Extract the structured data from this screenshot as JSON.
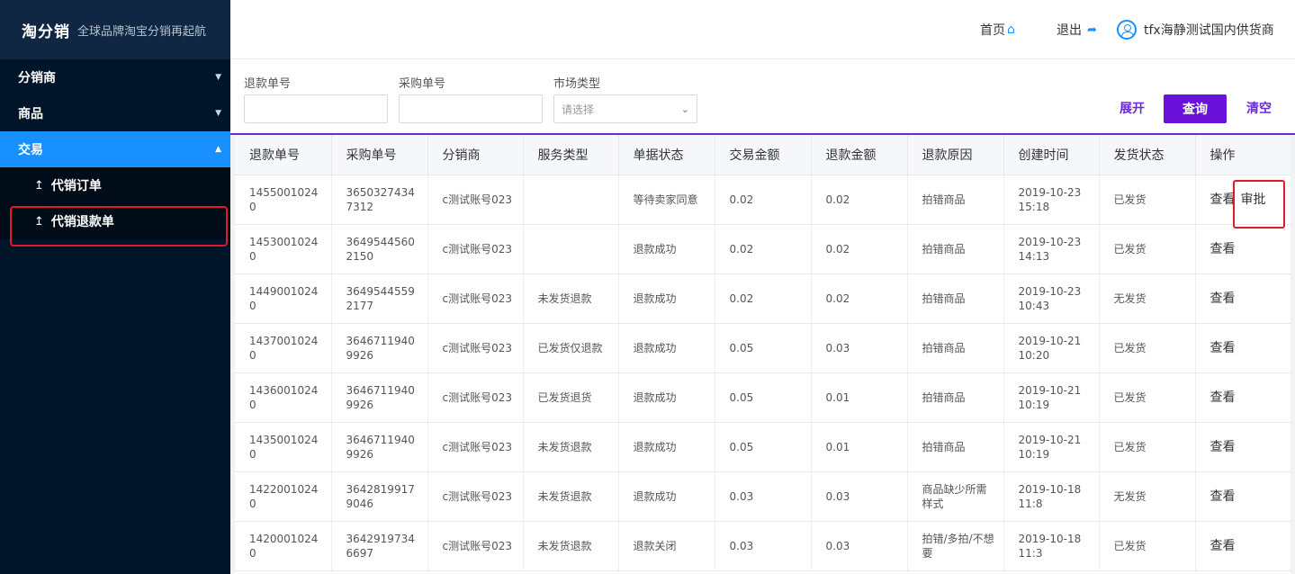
{
  "sidebar": {
    "brand": "淘分销",
    "slogan": "全球品牌淘宝分销再起航",
    "groups": [
      {
        "label": "分销商"
      },
      {
        "label": "商品"
      },
      {
        "label": "交易"
      }
    ],
    "items": [
      {
        "label": "代销订单"
      },
      {
        "label": "代销退款单"
      }
    ]
  },
  "header": {
    "home_label": "首页",
    "logout_label": "退出",
    "user_name": "tfx海静测试国内供货商"
  },
  "filters": {
    "refund_no_label": "退款单号",
    "purchase_no_label": "采购单号",
    "market_type_label": "市场类型",
    "market_type_placeholder": "请选择",
    "expand_label": "展开",
    "query_label": "查询",
    "clear_label": "清空"
  },
  "table": {
    "columns": [
      "退款单号",
      "采购单号",
      "分销商",
      "服务类型",
      "单据状态",
      "交易金额",
      "退款金额",
      "退款原因",
      "创建时间",
      "发货状态",
      "操作"
    ],
    "view_label": "查看",
    "approve_label": "审批",
    "rows": [
      {
        "refund_no": "14550010240",
        "purchase_no": "36503274347312",
        "distributor": "c测试账号023",
        "service": "",
        "status": "等待卖家同意",
        "trade_amt": "0.02",
        "refund_amt": "0.02",
        "reason": "拍错商品",
        "created": "2019-10-23 15:18",
        "ship": "已发货",
        "approve": true
      },
      {
        "refund_no": "14530010240",
        "purchase_no": "36495445602150",
        "distributor": "c测试账号023",
        "service": "",
        "status": "退款成功",
        "trade_amt": "0.02",
        "refund_amt": "0.02",
        "reason": "拍错商品",
        "created": "2019-10-23 14:13",
        "ship": "已发货"
      },
      {
        "refund_no": "14490010240",
        "purchase_no": "36495445592177",
        "distributor": "c测试账号023",
        "service": "未发货退款",
        "status": "退款成功",
        "trade_amt": "0.02",
        "refund_amt": "0.02",
        "reason": "拍错商品",
        "created": "2019-10-23 10:43",
        "ship": "无发货"
      },
      {
        "refund_no": "14370010240",
        "purchase_no": "36467119409926",
        "distributor": "c测试账号023",
        "service": "已发货仅退款",
        "status": "退款成功",
        "trade_amt": "0.05",
        "refund_amt": "0.03",
        "reason": "拍错商品",
        "created": "2019-10-21 10:20",
        "ship": "已发货"
      },
      {
        "refund_no": "14360010240",
        "purchase_no": "36467119409926",
        "distributor": "c测试账号023",
        "service": "已发货退货",
        "status": "退款成功",
        "trade_amt": "0.05",
        "refund_amt": "0.01",
        "reason": "拍错商品",
        "created": "2019-10-21 10:19",
        "ship": "已发货"
      },
      {
        "refund_no": "14350010240",
        "purchase_no": "36467119409926",
        "distributor": "c测试账号023",
        "service": "未发货退款",
        "status": "退款成功",
        "trade_amt": "0.05",
        "refund_amt": "0.01",
        "reason": "拍错商品",
        "created": "2019-10-21 10:19",
        "ship": "已发货"
      },
      {
        "refund_no": "14220010240",
        "purchase_no": "36428199179046",
        "distributor": "c测试账号023",
        "service": "未发货退款",
        "status": "退款成功",
        "trade_amt": "0.03",
        "refund_amt": "0.03",
        "reason": "商品缺少所需样式",
        "created": "2019-10-18 11:8",
        "ship": "无发货"
      },
      {
        "refund_no": "14200010240",
        "purchase_no": "36429197346697",
        "distributor": "c测试账号023",
        "service": "未发货退款",
        "status": "退款关闭",
        "trade_amt": "0.03",
        "refund_amt": "0.03",
        "reason": "拍错/多拍/不想要",
        "created": "2019-10-18 11:3",
        "ship": "已发货"
      }
    ]
  }
}
